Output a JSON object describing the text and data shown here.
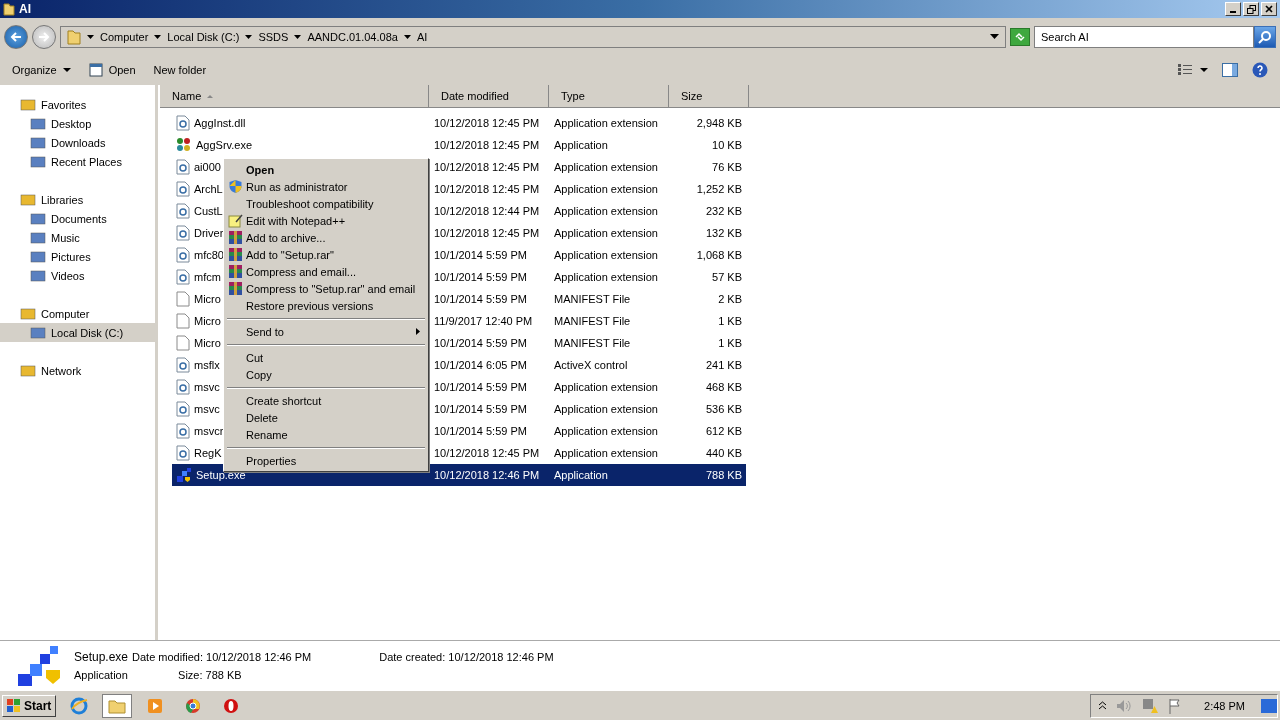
{
  "window": {
    "title": "AI"
  },
  "address": {
    "crumbs": [
      "Computer",
      "Local Disk (C:)",
      "SSDS",
      "AANDC.01.04.08a",
      "AI"
    ]
  },
  "search": {
    "placeholder": "Search AI"
  },
  "toolbar": {
    "organize": "Organize",
    "open": "Open",
    "new_folder": "New folder"
  },
  "sidebar": {
    "groups": [
      {
        "label": "Favorites",
        "selected": false,
        "children": [
          {
            "label": "Desktop",
            "selected": false
          },
          {
            "label": "Downloads",
            "selected": false
          },
          {
            "label": "Recent Places",
            "selected": false
          }
        ]
      },
      {
        "label": "Libraries",
        "selected": false,
        "children": [
          {
            "label": "Documents",
            "selected": false
          },
          {
            "label": "Music",
            "selected": false
          },
          {
            "label": "Pictures",
            "selected": false
          },
          {
            "label": "Videos",
            "selected": false
          }
        ]
      },
      {
        "label": "Computer",
        "selected": false,
        "children": [
          {
            "label": "Local Disk (C:)",
            "selected": true
          }
        ]
      },
      {
        "label": "Network",
        "selected": false
      }
    ]
  },
  "table": {
    "columns": [
      {
        "label": "Name",
        "sorted": true
      },
      {
        "label": "Date modified",
        "sorted": false
      },
      {
        "label": "Type",
        "sorted": false
      },
      {
        "label": "Size",
        "sorted": false
      }
    ],
    "rows": [
      {
        "kind": "extension",
        "name": "AggInst.dll",
        "date": "10/12/2018 12:45 PM",
        "type": "Application extension",
        "size": "2,948 KB",
        "selected": false
      },
      {
        "kind": "app",
        "name": "AggSrv.exe",
        "date": "10/12/2018 12:45 PM",
        "type": "Application",
        "size": "10 KB",
        "selected": false
      },
      {
        "kind": "extension",
        "name": "ai000",
        "date": "10/12/2018 12:45 PM",
        "type": "Application extension",
        "size": "76 KB",
        "selected": false
      },
      {
        "kind": "extension",
        "name": "ArchL",
        "date": "10/12/2018 12:45 PM",
        "type": "Application extension",
        "size": "1,252 KB",
        "selected": false
      },
      {
        "kind": "extension",
        "name": "CustL",
        "date": "10/12/2018 12:44 PM",
        "type": "Application extension",
        "size": "232 KB",
        "selected": false
      },
      {
        "kind": "extension",
        "name": "Driver",
        "date": "10/12/2018 12:45 PM",
        "type": "Application extension",
        "size": "132 KB",
        "selected": false
      },
      {
        "kind": "extension",
        "name": "mfc80",
        "date": "10/1/2014 5:59 PM",
        "type": "Application extension",
        "size": "1,068 KB",
        "selected": false
      },
      {
        "kind": "extension",
        "name": "mfcm",
        "date": "10/1/2014 5:59 PM",
        "type": "Application extension",
        "size": "57 KB",
        "selected": false
      },
      {
        "kind": "blank",
        "name": "Micro",
        "date": "10/1/2014 5:59 PM",
        "type": "MANIFEST File",
        "size": "2 KB",
        "selected": false
      },
      {
        "kind": "blank",
        "name": "Micro",
        "date": "11/9/2017 12:40 PM",
        "type": "MANIFEST File",
        "size": "1 KB",
        "selected": false
      },
      {
        "kind": "blank",
        "name": "Micro",
        "date": "10/1/2014 5:59 PM",
        "type": "MANIFEST File",
        "size": "1 KB",
        "selected": false
      },
      {
        "kind": "extension",
        "name": "msflx",
        "date": "10/1/2014 6:05 PM",
        "type": "ActiveX control",
        "size": "241 KB",
        "selected": false
      },
      {
        "kind": "extension",
        "name": "msvc",
        "date": "10/1/2014 5:59 PM",
        "type": "Application extension",
        "size": "468 KB",
        "selected": false
      },
      {
        "kind": "extension",
        "name": "msvc",
        "date": "10/1/2014 5:59 PM",
        "type": "Application extension",
        "size": "536 KB",
        "selected": false
      },
      {
        "kind": "extension",
        "name": "msvcr",
        "date": "10/1/2014 5:59 PM",
        "type": "Application extension",
        "size": "612 KB",
        "selected": false
      },
      {
        "kind": "extension",
        "name": "RegK",
        "date": "10/12/2018 12:45 PM",
        "type": "Application extension",
        "size": "440 KB",
        "selected": false
      },
      {
        "kind": "setup",
        "name": "Setup.exe",
        "date": "10/12/2018 12:46 PM",
        "type": "Application",
        "size": "788 KB",
        "selected": true
      }
    ]
  },
  "context_menu": [
    {
      "kind": "item",
      "label": "Open",
      "bold": true
    },
    {
      "kind": "admin",
      "label": "Run as administrator",
      "bold": false
    },
    {
      "kind": "item",
      "label": "Troubleshoot compatibility"
    },
    {
      "kind": "editor",
      "label": "Edit with Notepad++"
    },
    {
      "kind": "archive",
      "label": "Add to archive..."
    },
    {
      "kind": "archive",
      "label": "Add to \"Setup.rar\""
    },
    {
      "kind": "archive",
      "label": "Compress and email..."
    },
    {
      "kind": "archive",
      "label": "Compress to \"Setup.rar\" and email"
    },
    {
      "kind": "item",
      "label": "Restore previous versions"
    },
    {
      "kind": "separator"
    },
    {
      "kind": "item",
      "label": "Send to",
      "submenu": true
    },
    {
      "kind": "separator"
    },
    {
      "kind": "item",
      "label": "Cut"
    },
    {
      "kind": "item",
      "label": "Copy"
    },
    {
      "kind": "separator"
    },
    {
      "kind": "item",
      "label": "Create shortcut"
    },
    {
      "kind": "item",
      "label": "Delete"
    },
    {
      "kind": "item",
      "label": "Rename"
    },
    {
      "kind": "separator"
    },
    {
      "kind": "item",
      "label": "Properties"
    }
  ],
  "details": {
    "name": "Setup.exe",
    "type": "Application",
    "fields": [
      {
        "label": "Date modified:",
        "value": "10/12/2018 12:46 PM"
      },
      {
        "label": "Date created:",
        "value": "10/12/2018 12:46 PM"
      },
      {
        "label": "Size:",
        "value": "788 KB"
      }
    ]
  },
  "taskbar": {
    "start": "Start",
    "apps": [
      {
        "selected": false
      },
      {
        "selected": true
      },
      {
        "selected": false
      },
      {
        "selected": false
      },
      {
        "selected": false
      }
    ],
    "clock": "2:48 PM"
  }
}
